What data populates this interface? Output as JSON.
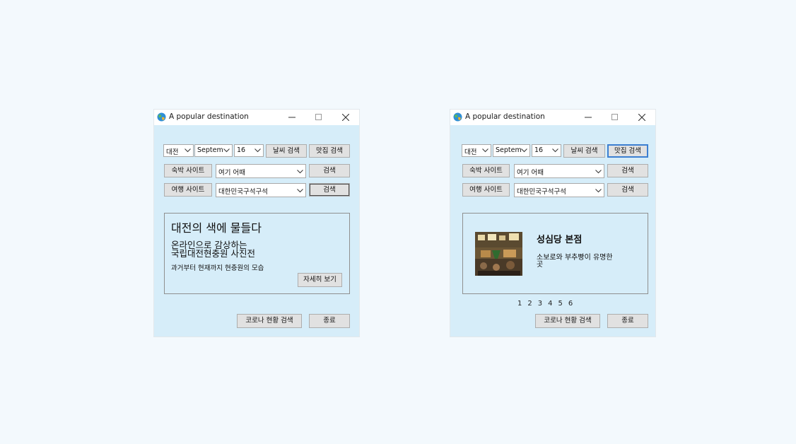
{
  "left_window": {
    "title": "A popular destination",
    "region": "대전",
    "month": "Septem",
    "day": "16",
    "weather_button": "날씨 검색",
    "food_button": "맛집 검색",
    "lodging_button": "숙박 사이트",
    "lodging_combo": "여기 어때",
    "lodging_search": "검색",
    "travel_button": "여행 사이트",
    "travel_combo": "대한민국구석구석",
    "travel_search": "검색",
    "card": {
      "headline": "대전의 색에 물들다",
      "subtitle_line1": "온라인으로 감상하는",
      "subtitle_line2": "국립대전현충원 사진전",
      "caption": "과거부터 현재까지 현충원의 모습",
      "detail_button": "자세히 보기"
    },
    "covid_button": "코로나 현황 검색",
    "exit_button": "종료"
  },
  "right_window": {
    "title": "A popular destination",
    "region": "대전",
    "month": "Septem",
    "day": "16",
    "weather_button": "날씨 검색",
    "food_button": "맛집 검색",
    "lodging_button": "숙박 사이트",
    "lodging_combo": "여기 어때",
    "lodging_search": "검색",
    "travel_button": "여행 사이트",
    "travel_combo": "대한민국구석구석",
    "travel_search": "검색",
    "place": {
      "name": "성심당 본점",
      "desc_line1": "소보로와 부추빵이 유명한",
      "desc_line2": "곳"
    },
    "pages": [
      "1",
      "2",
      "3",
      "4",
      "5",
      "6"
    ],
    "covid_button": "코로나 현황 검색",
    "exit_button": "종료"
  },
  "colors": {
    "window_bg": "#d6edf9",
    "page_bg": "#f3f9fd",
    "focus_blue": "#3c7fd1"
  },
  "icons": [
    "app-globe-icon",
    "minimize-icon",
    "maximize-icon",
    "close-icon",
    "chevron-down-icon"
  ]
}
